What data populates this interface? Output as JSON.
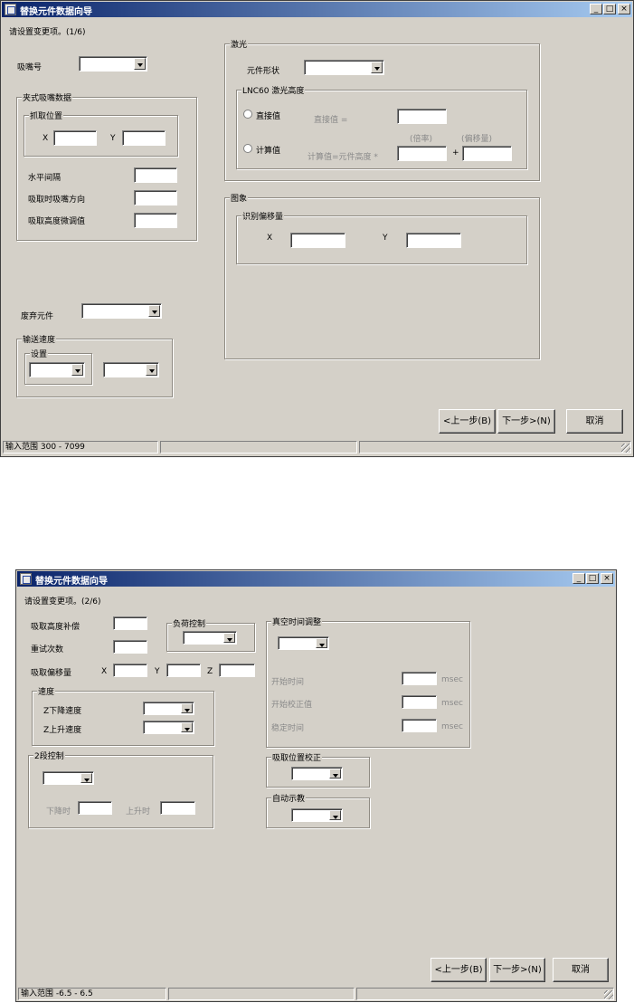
{
  "w1": {
    "title": "替换元件数据向导",
    "step_text": "请设置变更项。(1/6)",
    "nozzle_label": "吸嘴号",
    "nozzle_group": "夹式吸嘴数据",
    "pick_group": "抓取位置",
    "x_label": "X",
    "y_label": "Y",
    "h_spacing": "水平间隔",
    "nozzle_dir": "吸取时吸嘴方向",
    "height_adj": "吸取高度微调值",
    "discard": "废弃元件",
    "speed_group": "输送速度",
    "setting_group": "设置",
    "laser_group": "激光",
    "shape_label": "元件形状",
    "lnc_group": "LNC60 激光高度",
    "direct_radio": "直接值",
    "direct_eq": "直接值 =",
    "calc_radio": "计算值",
    "calc_eq": "计算值=元件高度 *",
    "rate_label": "(倍率)",
    "offset_label": "(偏移量)",
    "plus": "+",
    "image_group": "图象",
    "recog_group": "识别偏移量",
    "ix_label": "X",
    "iy_label": "Y",
    "prev": "<上一步(B)",
    "next": "下一步>(N)",
    "cancel": "取消",
    "status": "输入范围 300 - 7099"
  },
  "w2": {
    "title": "替换元件数据向导",
    "step_text": "请设置变更项。(2/6)",
    "pick_height": "吸取高度补偿",
    "retry": "重试次数",
    "pick_offset": "吸取偏移量",
    "x_label": "X",
    "y_label": "Y",
    "z_label": "Z",
    "load_group": "负荷控制",
    "speed_group": "速度",
    "z_down": "Z下降速度",
    "z_up": "Z上升速度",
    "stage2_group": "2段控制",
    "down_at": "下降时",
    "up_at": "上升时",
    "vacuum_group": "真空时间调整",
    "open_time": "开始时间",
    "open_check": "开始校正值",
    "stable_time": "稳定时间",
    "msec": "msec",
    "pickpos_group": "吸取位置校正",
    "autocount_group": "自动示教",
    "prev": "<上一步(B)",
    "next": "下一步>(N)",
    "cancel": "取消",
    "status": "输入范围 -6.5 - 6.5"
  }
}
